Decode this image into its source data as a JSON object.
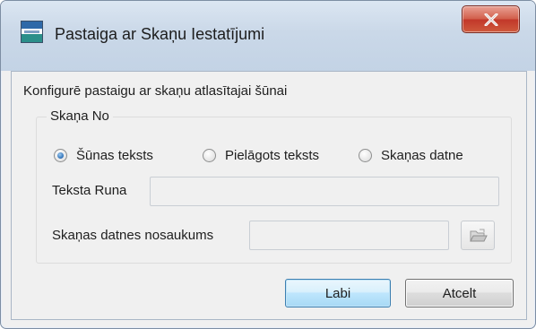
{
  "window": {
    "title": "Pastaiga ar Skaņu Iestatījumi",
    "close_icon": "close-x-icon"
  },
  "dialog": {
    "description": "Konfigurē  pastaigu ar skaņu atlasītajai šūnai",
    "group_title": "Skaņa No",
    "radios": [
      {
        "label": "Šūnas teksts",
        "checked": true
      },
      {
        "label": "Pielāgots teksts",
        "checked": false
      },
      {
        "label": "Skaņas datne",
        "checked": false
      }
    ],
    "text_rune_label": "Teksta Runa",
    "text_rune_value": "",
    "sound_file_label": "Skaņas datnes nosaukums",
    "sound_file_value": "",
    "browse_icon": "folder-open-icon"
  },
  "buttons": {
    "ok_label": "Labi",
    "cancel_label": "Atcelt"
  },
  "colors": {
    "window_bg": "#f0f0f0",
    "titlebar": "#cad8e8",
    "close_button": "#c2382a",
    "ok_border": "#3c7fb1"
  }
}
